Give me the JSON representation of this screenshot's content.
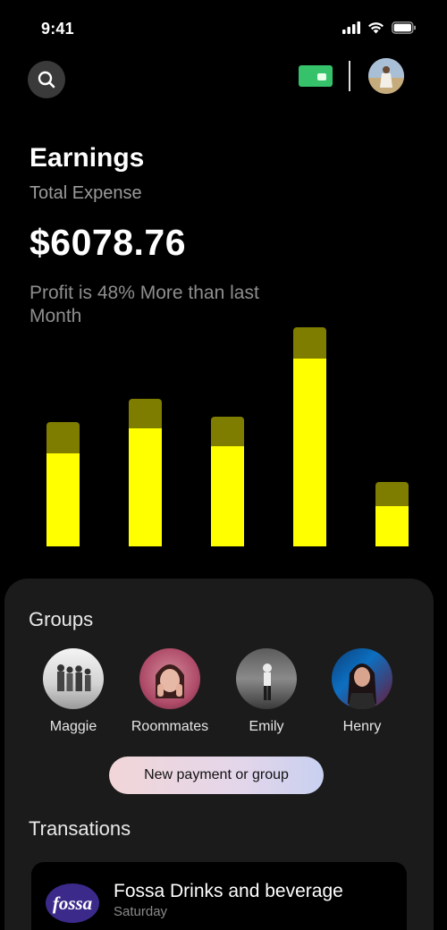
{
  "status_bar": {
    "time": "9:41"
  },
  "header": {
    "search_icon": "search-icon",
    "card_icon": "credit-card-icon",
    "card_color": "#35c26a"
  },
  "earnings": {
    "title": "Earnings",
    "subtitle": "Total Expense",
    "amount": "$6078.76",
    "profit_note": "Profit is 48% More than last Month"
  },
  "chart_data": {
    "type": "bar",
    "stacked": true,
    "categories": [
      "",
      "",
      "",
      "",
      ""
    ],
    "series": [
      {
        "values": [
          104,
          132,
          112,
          210,
          45
        ],
        "color": "#ffff00"
      },
      {
        "values": [
          35,
          33,
          33,
          35,
          27
        ],
        "color": "#7f7d00"
      }
    ],
    "ylim": [
      0,
      245
    ]
  },
  "groups": {
    "title": "Groups",
    "items": [
      {
        "name": "Maggie"
      },
      {
        "name": "Roommates"
      },
      {
        "name": "Emily"
      },
      {
        "name": "Henry"
      }
    ],
    "new_button": "New payment or group"
  },
  "transactions": {
    "title": "Transations",
    "items": [
      {
        "logo_text": "fossa",
        "name": "Fossa Drinks and beverage",
        "day": "Saturday"
      }
    ]
  }
}
